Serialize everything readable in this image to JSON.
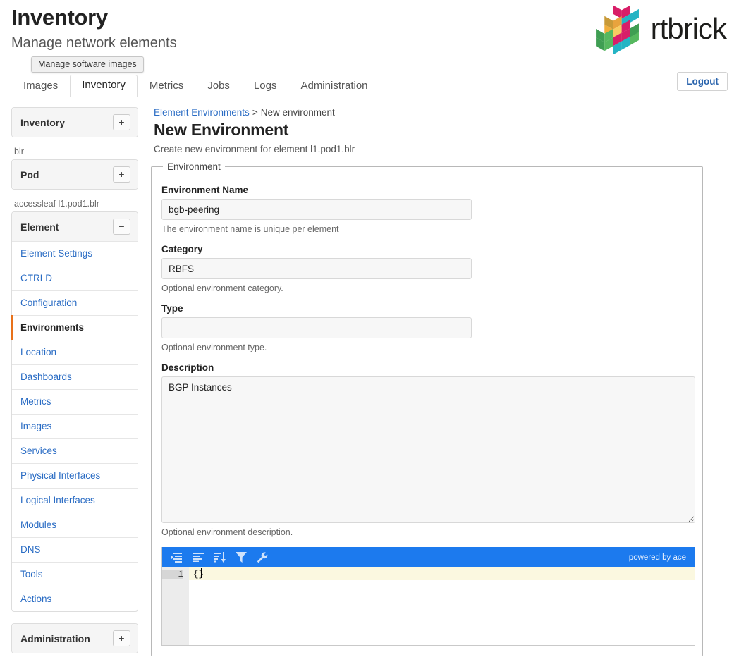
{
  "header": {
    "title": "Inventory",
    "subtitle": "Manage network elements",
    "logo_text": "rtbrick",
    "tooltip": "Manage software images",
    "logout_label": "Logout"
  },
  "tabs": [
    {
      "label": "Images",
      "active": false
    },
    {
      "label": "Inventory",
      "active": true
    },
    {
      "label": "Metrics",
      "active": false
    },
    {
      "label": "Jobs",
      "active": false
    },
    {
      "label": "Logs",
      "active": false
    },
    {
      "label": "Administration",
      "active": false
    }
  ],
  "sidebar": {
    "inventory_panel": {
      "title": "Inventory",
      "toggle": "+"
    },
    "pod_group_label": "blr",
    "pod_panel": {
      "title": "Pod",
      "toggle": "+"
    },
    "element_group_label": "accessleaf l1.pod1.blr",
    "element_panel": {
      "title": "Element",
      "toggle": "−"
    },
    "element_items": [
      {
        "label": "Element Settings",
        "active": false
      },
      {
        "label": "CTRLD",
        "active": false
      },
      {
        "label": "Configuration",
        "active": false
      },
      {
        "label": "Environments",
        "active": true
      },
      {
        "label": "Location",
        "active": false
      },
      {
        "label": "Dashboards",
        "active": false
      },
      {
        "label": "Metrics",
        "active": false
      },
      {
        "label": "Images",
        "active": false
      },
      {
        "label": "Services",
        "active": false
      },
      {
        "label": "Physical Interfaces",
        "active": false
      },
      {
        "label": "Logical Interfaces",
        "active": false
      },
      {
        "label": "Modules",
        "active": false
      },
      {
        "label": "DNS",
        "active": false
      },
      {
        "label": "Tools",
        "active": false
      },
      {
        "label": "Actions",
        "active": false
      }
    ],
    "administration_panel": {
      "title": "Administration",
      "toggle": "+"
    }
  },
  "main": {
    "breadcrumb_link": "Element Environments",
    "breadcrumb_separator": ">",
    "breadcrumb_current": "New environment",
    "page_title": "New Environment",
    "page_description": "Create new environment for element l1.pod1.blr",
    "fieldset_legend": "Environment",
    "fields": {
      "name": {
        "label": "Environment Name",
        "value": "bgb-peering",
        "placeholder": "",
        "hint": "The environment name is unique per element"
      },
      "category": {
        "label": "Category",
        "value": "RBFS",
        "placeholder": "",
        "hint": "Optional environment category."
      },
      "type": {
        "label": "Type",
        "value": "",
        "placeholder": "",
        "hint": "Optional environment type."
      },
      "description": {
        "label": "Description",
        "value": "BGP Instances",
        "placeholder": "",
        "hint": "Optional environment description."
      }
    },
    "editor": {
      "brand": "powered by ace",
      "toolbar_icons": [
        "indent-icon",
        "align-left-icon",
        "sort-descending-icon",
        "filter-icon",
        "wrench-icon"
      ],
      "line_numbers": [
        "1"
      ],
      "line_content": "{}",
      "accent_color": "#1c7aee"
    }
  },
  "colors": {
    "accent_blue": "#1c7aee",
    "link_blue": "#2a6cc4",
    "active_marker_orange": "#e8711a",
    "panel_head_bg": "#f5f5f5"
  }
}
